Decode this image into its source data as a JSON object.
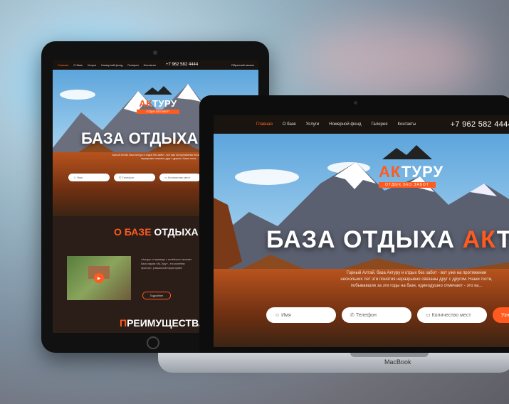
{
  "site": {
    "nav": [
      "Главная",
      "О базе",
      "Услуги",
      "Номерной фонд",
      "Галерея",
      "Контакты"
    ],
    "phone": "+7 962 582 4444",
    "callback": "Обратный звонок",
    "logo_ak": "АК",
    "logo_rest": "ТУРУ",
    "logo_tagline": "ОТДЫХ БЕЗ ЗАБОТ",
    "hero_title_main": "БАЗА ОТДЫХА ",
    "hero_title_accent": "АК",
    "hero_title_tail": "ТУРУ",
    "hero_desc_line1": "Горный Алтай, база Актуру и отдых без забот - вот уже на протяжении",
    "hero_desc_line2": "нескольких лет эти понятия неразрывно связаны друг с другом. Наши гости,",
    "hero_desc_line3": "побывавшие за эти годы на базе, единодушно отмечают - это ка...",
    "form": {
      "name": "Имя",
      "phone": "Телефон",
      "guests": "Количество мест",
      "submit": "Узна"
    },
    "about_accent": "О БАЗЕ",
    "about_rest": " ОТДЫХА",
    "about_text1": "«Актуру» и переводе с алтайского означает",
    "about_text2": "База отдыха «Ак-Туру» - это комплекс",
    "about_text3": "простор», уникальной территорией",
    "about_more": "Подробнее",
    "advantages_first": "П",
    "advantages_rest": "РЕИМУЩЕСТВА"
  },
  "device": {
    "laptop_brand": "MacBook"
  },
  "colors": {
    "accent": "#ff5a1f",
    "nav_bg": "#1a1410",
    "page_bg": "#2b1d17"
  }
}
